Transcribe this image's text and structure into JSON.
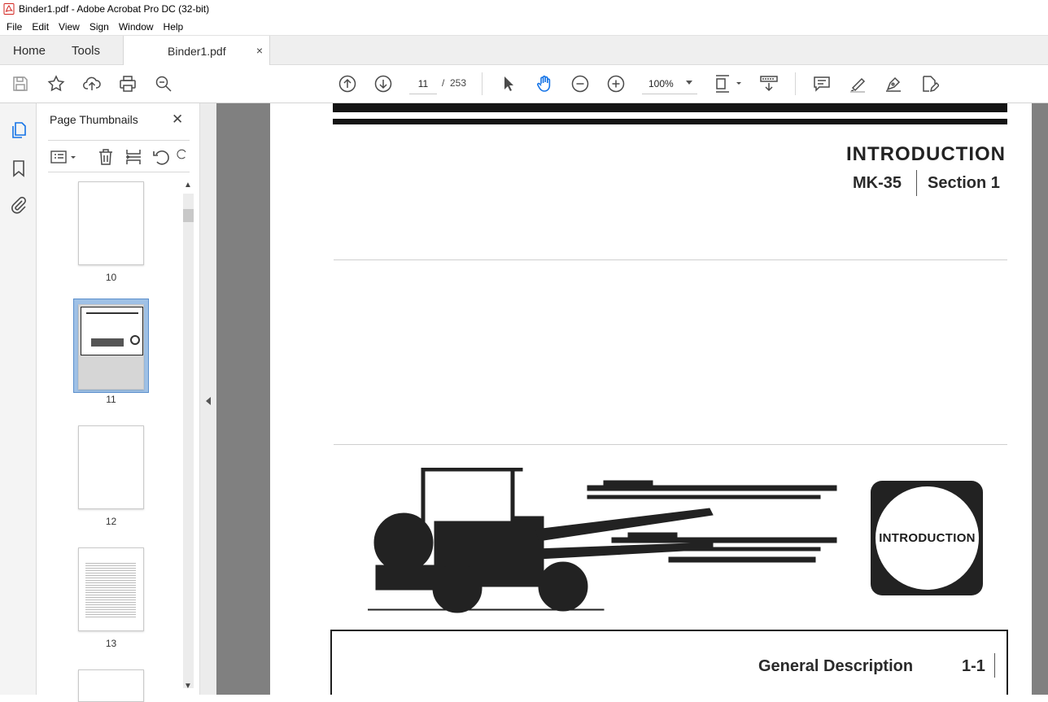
{
  "window": {
    "title": "Binder1.pdf - Adobe Acrobat Pro DC (32-bit)",
    "app_icon": "acrobat-pdf-icon"
  },
  "menu": {
    "items": [
      "File",
      "Edit",
      "View",
      "Sign",
      "Window",
      "Help"
    ]
  },
  "tabs": {
    "home": "Home",
    "tools": "Tools",
    "document": "Binder1.pdf",
    "close_glyph": "×"
  },
  "toolbar": {
    "icons": [
      "save-icon",
      "bookmark-star-icon",
      "upload-cloud-icon",
      "print-icon",
      "zoom-search-icon",
      "page-up-icon",
      "page-down-icon",
      "select-cursor-icon",
      "hand-tool-icon",
      "zoom-out-icon",
      "zoom-in-icon",
      "fit-page-icon",
      "scroll-mode-icon",
      "comment-icon",
      "highlight-icon",
      "sign-pen-icon",
      "edit-pdf-icon"
    ],
    "current_page": "11",
    "page_separator": "/",
    "total_pages": "253",
    "zoom": "100%",
    "accent_color": "#1473e6"
  },
  "sidebar": {
    "title": "Page Thumbnails",
    "close_glyph": "✕",
    "thumbnails": [
      {
        "label": "10"
      },
      {
        "label": "11",
        "selected": true
      },
      {
        "label": "12"
      },
      {
        "label": "13"
      }
    ],
    "selection_color": "#9fc1e6"
  },
  "document": {
    "heading": "INTRODUCTION",
    "model": "MK-35",
    "section": "Section 1",
    "badge": "INTRODUCTION",
    "footer_label": "General Description",
    "footer_page": "1-1"
  }
}
